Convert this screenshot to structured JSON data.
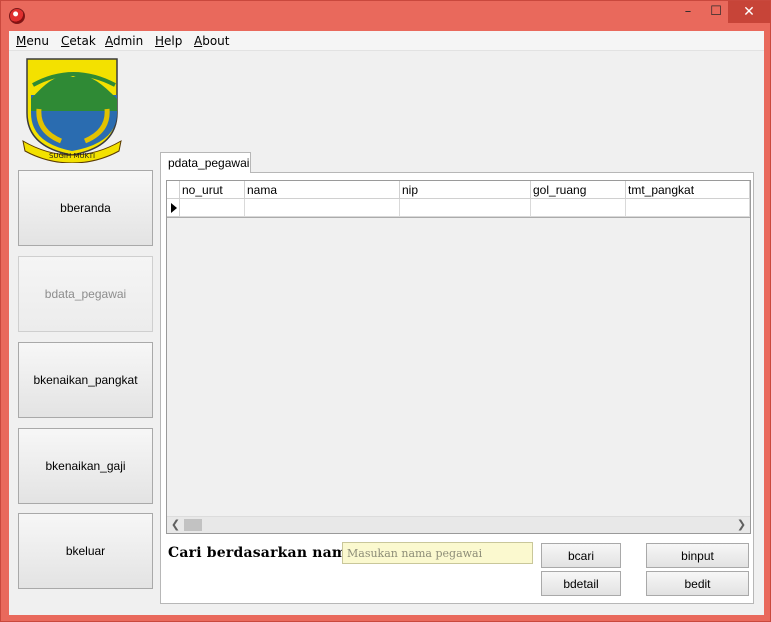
{
  "window": {
    "icon": "app-red-orb-icon",
    "controls": {
      "minimize": "–",
      "maximize": "☐",
      "close": "✕"
    },
    "colors": {
      "frame": "#e9695c",
      "close_button": "#c74438",
      "client": "#f0f0f0",
      "search_input_bg": "#fbf9cf"
    }
  },
  "menu": {
    "items": [
      {
        "first": "M",
        "rest": "enu"
      },
      {
        "first": "C",
        "rest": "etak"
      },
      {
        "first": "A",
        "rest": "dmin"
      },
      {
        "first": "H",
        "rest": "elp"
      },
      {
        "first": "A",
        "rest": "bout"
      }
    ]
  },
  "logo": {
    "banner_text": "SUGIH MUKTI"
  },
  "sidebar": {
    "buttons": [
      {
        "label": "bberanda",
        "enabled": true
      },
      {
        "label": "bdata_pegawai",
        "enabled": false
      },
      {
        "label": "bkenaikan_pangkat",
        "enabled": true
      },
      {
        "label": "bkenaikan_gaji",
        "enabled": true
      },
      {
        "label": "bkeluar",
        "enabled": true
      }
    ]
  },
  "main": {
    "tab_label": "pdata_pegawai",
    "grid": {
      "columns": [
        "no_urut",
        "nama",
        "nip",
        "gol_ruang",
        "tmt_pangkat"
      ],
      "rows": [
        [
          "",
          "",
          "",
          "",
          ""
        ]
      ]
    },
    "search": {
      "label": "Cari berdasarkan nama",
      "placeholder": "Masukan nama pegawai",
      "value": ""
    },
    "buttons": {
      "cari": "bcari",
      "detail": "bdetail",
      "input": "binput",
      "edit": "bedit"
    }
  }
}
